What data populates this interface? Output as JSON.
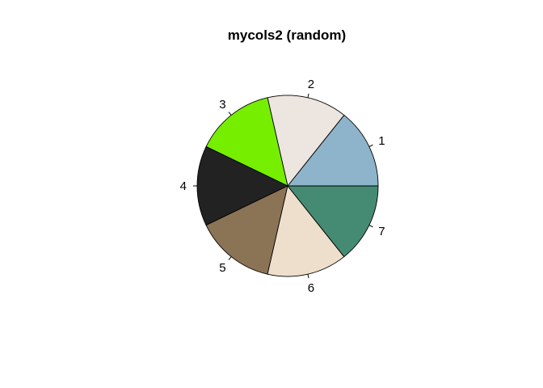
{
  "chart_data": {
    "type": "pie",
    "title": "mycols2 (random)",
    "direction": "counterclockwise",
    "start_angle_deg": 0,
    "labels": [
      "1",
      "2",
      "3",
      "4",
      "5",
      "6",
      "7"
    ],
    "values": [
      1,
      1,
      1,
      1,
      1,
      1,
      1
    ],
    "colors": [
      "#8db4ca",
      "#ede5e0",
      "#76ee00",
      "#222222",
      "#8b7355",
      "#eedfcc",
      "#458b74"
    ],
    "border_color": "#000000"
  }
}
